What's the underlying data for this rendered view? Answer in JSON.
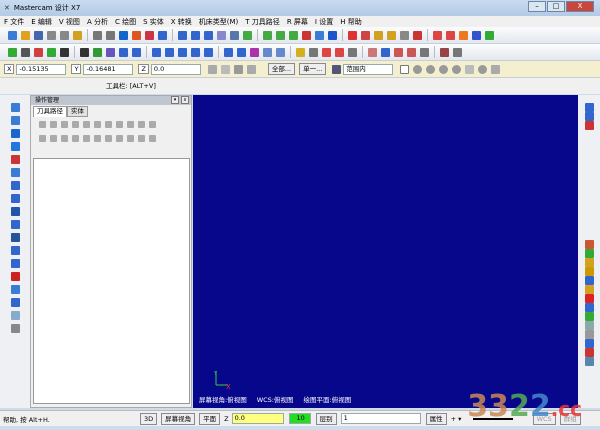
{
  "window": {
    "title": "Mastercam 设计 X7",
    "min": "–",
    "max": "□",
    "close": "X"
  },
  "menu": [
    "F 文件",
    "E 编辑",
    "V 视图",
    "A 分析",
    "C 绘图",
    "S 实体",
    "X 转换",
    "机床类型(M)",
    "T 刀具路径",
    "R 屏幕",
    "I 设置",
    "H 帮助"
  ],
  "toolbars": {
    "row1": [
      "#3a7bd5",
      "#e0a020",
      "#4466aa",
      "#888",
      "#888",
      "#d4a020",
      "#777",
      "#777",
      "#1166cc",
      "#dd5522",
      "#cc3344",
      "#3366cc",
      "#3366cc",
      "#3366cc",
      "#3366cc",
      "#8888cc",
      "#5577aa",
      "#44aa44",
      "#44aa44",
      "#44aa44",
      "#44aa44",
      "#cc3333",
      "#3a7bd5",
      "#1a55cc",
      "#dd3333",
      "#cc4444",
      "#d4a020",
      "#d4a020",
      "#888",
      "#cc3333",
      "#dd4444",
      "#dd4444",
      "#ee7722",
      "#3355cc",
      "#33aa33"
    ],
    "row2": [
      "#33aa33",
      "#555",
      "#d04040",
      "#33aa33",
      "#333",
      "#333",
      "#339933",
      "#6655bb",
      "#3366cc",
      "#3366cc",
      "#3366cc",
      "#3366cc",
      "#3366cc",
      "#3366cc",
      "#3366cc",
      "#3366cc",
      "#3366cc",
      "#aa33aa",
      "#6688cc",
      "#6688cc",
      "#d4b020",
      "#777",
      "#dd4444",
      "#dd4444",
      "#777",
      "#cc7777",
      "#3366cc",
      "#cc5555",
      "#cc5555",
      "#777",
      "#994444",
      "#777"
    ]
  },
  "coords": {
    "x_label": "X",
    "x_value": "-0.15135",
    "y_label": "Y",
    "y_value": "-0.16481",
    "z_label": "Z",
    "z_value": "0.0",
    "all_button": "全部...",
    "single_button": "单一...",
    "range_select": "范围内"
  },
  "toolbar_label": "工具栏: [ALT+V]",
  "left_strip": [
    "#3a7bd5",
    "#3a7bd5",
    "#1a66cc",
    "#2277dd",
    "#cc3333",
    "#3a7bd5",
    "#3366cc",
    "#3366cc",
    "#2255aa",
    "#3366cc",
    "#225599",
    "#3366cc",
    "#3366cc",
    "#cc2222",
    "#3a7bd5",
    "#3366cc",
    "#88aacc",
    "#888"
  ],
  "panel": {
    "title": "操作管理",
    "tabs": [
      "刀具路径",
      "实体"
    ],
    "close": "x",
    "menu": "▾"
  },
  "viewport": {
    "bg": "#07078c",
    "screen_view": "屏幕视角:俯视图",
    "wcs": "WCS:俯视图",
    "plane": "绘图平面:俯视图",
    "axis_x": "X",
    "axis_y": "Y"
  },
  "right_strip": [
    "#3366cc",
    "#3366cc",
    "#cc3333",
    "#cc5533",
    "#33aa33",
    "#d4a020",
    "#cc9900",
    "#3366cc",
    "#d4a020",
    "#dd2222",
    "#3366cc",
    "#33aa33",
    "#88aaaa",
    "#999",
    "#3366cc",
    "#cc3333",
    "#5588aa"
  ],
  "status": {
    "help": "帮助, 按 Alt+H.",
    "btn_3d": "3D",
    "screen_view": "屏幕视角",
    "plane": "平面",
    "z_label": "Z",
    "z_value": "0.0",
    "level_color": "10",
    "level_label": "层别",
    "level_value": "1",
    "attributes": "属性",
    "wcs": "WCS",
    "group": "群组"
  },
  "watermark": {
    "text": "3322",
    "suffix": ".cc",
    "tag": "软件站"
  }
}
